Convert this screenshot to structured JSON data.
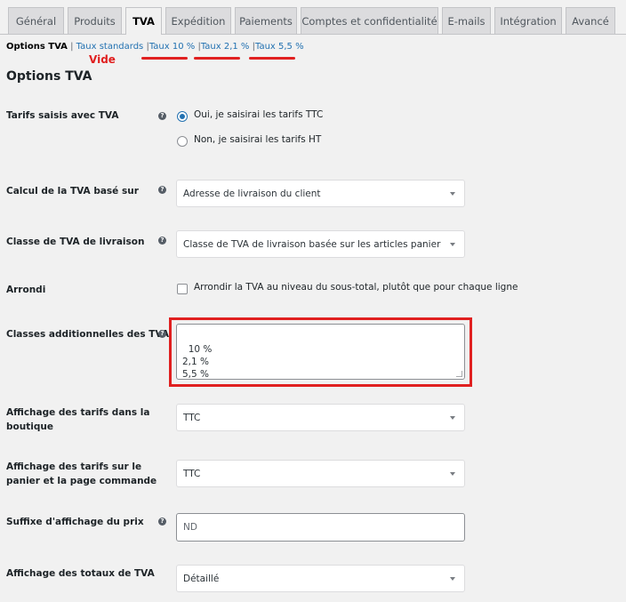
{
  "tabs": [
    "Général",
    "Produits",
    "TVA",
    "Expédition",
    "Paiements",
    "Comptes et confidentialité",
    "E-mails",
    "Intégration",
    "Avancé"
  ],
  "subnav": {
    "current": "Options TVA",
    "links": [
      "Taux standards",
      "Taux 10 %",
      "Taux 2,1 %",
      "Taux 5,5 %"
    ],
    "annotation": "Vide"
  },
  "section_title": "Options TVA",
  "fields": {
    "prices_with_tax": {
      "label": "Tarifs saisis avec TVA",
      "option_yes": "Oui, je saisirai les tarifs TTC",
      "option_no": "Non, je saisirai les tarifs HT"
    },
    "tax_based_on": {
      "label": "Calcul de la TVA basé sur",
      "value": "Adresse de livraison du client"
    },
    "shipping_tax_class": {
      "label": "Classe de TVA de livraison",
      "value": "Classe de TVA de livraison basée sur les articles panier"
    },
    "rounding": {
      "label": "Arrondi",
      "checkbox_label": "Arrondir la TVA au niveau du sous-total, plutôt que pour chaque ligne"
    },
    "additional_classes": {
      "label": "Classes additionnelles des TVA",
      "value": "10 %\n2,1 %\n5,5 %"
    },
    "shop_display": {
      "label_line1": "Affichage des tarifs dans la",
      "label_line2": "boutique",
      "value": "TTC"
    },
    "cart_display": {
      "label_line1": "Affichage des tarifs sur le",
      "label_line2": "panier et la page commande",
      "value": "TTC"
    },
    "price_suffix": {
      "label": "Suffixe d'affichage du prix",
      "placeholder": "ND"
    },
    "tax_totals": {
      "label": "Affichage des totaux de TVA",
      "value": "Détaillé"
    }
  },
  "help_glyph": "?",
  "colors": {
    "link": "#2271b1",
    "annotation_red": "#e02020",
    "radio_checked": "#2271b1"
  }
}
